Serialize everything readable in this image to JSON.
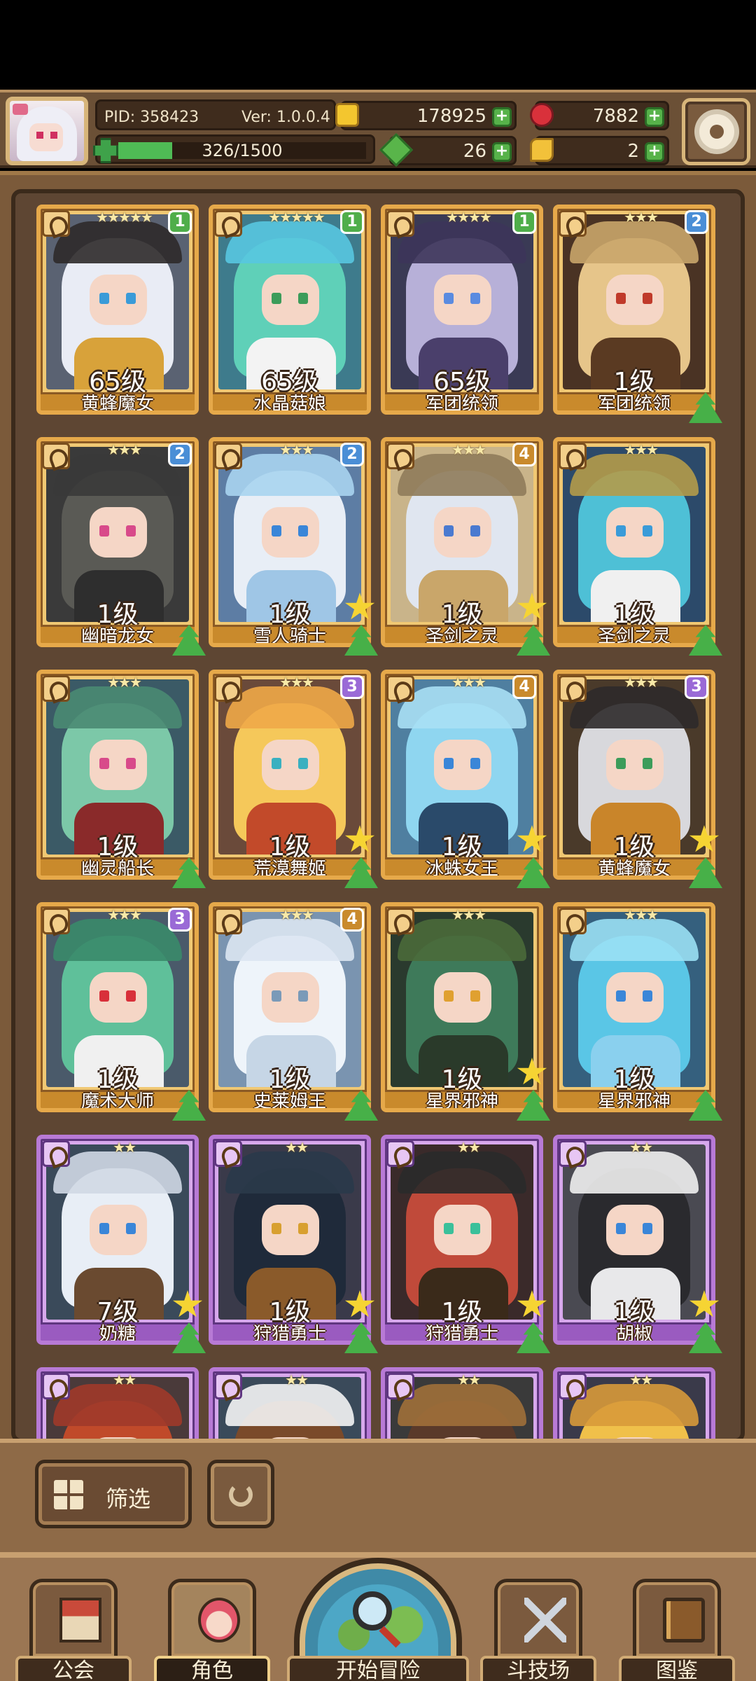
{
  "header": {
    "pid": "PID: 358423",
    "version": "Ver: 1.0.0.4",
    "exp_text": "326/1500",
    "exp_progress": 0.217,
    "gold": "178925",
    "gems": "7882",
    "leaves": "26",
    "keys": "2",
    "plus": "+"
  },
  "cards": [
    {
      "stars": "★★★★★",
      "badge": "1",
      "level": "65级",
      "name": "黄蜂魔女",
      "frame": "gold",
      "up": false,
      "star": false,
      "hair": "#e9ecf5",
      "body": "#d8a23a",
      "hat": "#2e2a2a",
      "eye": "#3a9bd8",
      "bg": "#5a6272"
    },
    {
      "stars": "★★★★★",
      "badge": "1",
      "level": "65级",
      "name": "水晶菇娘",
      "frame": "gold",
      "up": false,
      "star": false,
      "hair": "#5fd0b8",
      "body": "#f3f3f3",
      "hat": "#58c6e0",
      "eye": "#3c9c5a",
      "bg": "#3e7b8c"
    },
    {
      "stars": "★★★★",
      "badge": "1",
      "level": "65级",
      "name": "军团统领",
      "frame": "gold",
      "up": false,
      "star": false,
      "hair": "#b7b0d8",
      "body": "#4a3f6b",
      "hat": "#3d355a",
      "eye": "#5a8be0",
      "bg": "#3a3a55"
    },
    {
      "stars": "★★★",
      "badge": "2",
      "level": "1级",
      "name": "军团统领",
      "frame": "gold",
      "up": true,
      "star": false,
      "hair": "#e6c58a",
      "body": "#5a3a22",
      "hat": "#c9a56a",
      "eye": "#c03a2a",
      "bg": "#4a3324"
    },
    {
      "stars": "★★★",
      "badge": "2",
      "level": "1级",
      "name": "幽暗龙女",
      "frame": "gold",
      "up": true,
      "star": false,
      "hair": "#5a5a55",
      "body": "#2e2e2e",
      "hat": "#3a3a3a",
      "eye": "#d84a8a",
      "bg": "#3a3a3a"
    },
    {
      "stars": "★★★",
      "badge": "2",
      "level": "1级",
      "name": "雪人骑士",
      "frame": "gold",
      "up": true,
      "star": true,
      "hair": "#e8eef6",
      "body": "#9fc6e6",
      "hat": "#a8d4f0",
      "eye": "#3a86d8",
      "bg": "#5d7da4"
    },
    {
      "stars": "★★★",
      "badge": "4",
      "level": "1级",
      "name": "圣剑之灵",
      "frame": "gold",
      "up": true,
      "star": true,
      "hair": "#e0e6f0",
      "body": "#c9a66a",
      "hat": "#8f7b5a",
      "eye": "#4a7ad0",
      "bg": "#c9b48a"
    },
    {
      "stars": "★★★",
      "badge": "",
      "level": "1级",
      "name": "圣剑之灵",
      "frame": "gold",
      "up": true,
      "star": false,
      "hair": "#4ec0d6",
      "body": "#f0f0f0",
      "hat": "#b49b4a",
      "eye": "#3a9bd8",
      "bg": "#2c4a6a"
    },
    {
      "stars": "★★★",
      "badge": "",
      "level": "1级",
      "name": "幽灵船长",
      "frame": "gold",
      "up": true,
      "star": false,
      "hair": "#7cc8a8",
      "body": "#8a2a2a",
      "hat": "#4a8a72",
      "eye": "#d84a8a",
      "bg": "#3b5a66"
    },
    {
      "stars": "★★★",
      "badge": "3",
      "level": "1级",
      "name": "荒漠舞姬",
      "frame": "gold",
      "up": true,
      "star": true,
      "hair": "#f5c85a",
      "body": "#c24a2a",
      "hat": "#f0a848",
      "eye": "#3ab0c0",
      "bg": "#6a4a3a"
    },
    {
      "stars": "★★★",
      "badge": "4",
      "level": "1级",
      "name": "冰蛛女王",
      "frame": "gold",
      "up": true,
      "star": true,
      "hair": "#8fd6f0",
      "body": "#2a4a6a",
      "hat": "#a8e0f4",
      "eye": "#3a86d8",
      "bg": "#4f7fa0"
    },
    {
      "stars": "★★★",
      "badge": "3",
      "level": "1级",
      "name": "黄蜂魔女",
      "frame": "gold",
      "up": true,
      "star": true,
      "hair": "#d8d8dc",
      "body": "#c9852a",
      "hat": "#2e2a2a",
      "eye": "#3c9c5a",
      "bg": "#4a3a2a"
    },
    {
      "stars": "★★★",
      "badge": "3",
      "level": "1级",
      "name": "魔术大师",
      "frame": "gold",
      "up": true,
      "star": false,
      "hair": "#5fc09a",
      "body": "#f0f0f0",
      "hat": "#3a8a6a",
      "eye": "#d8303a",
      "bg": "#4a5a6a"
    },
    {
      "stars": "★★★",
      "badge": "4",
      "level": "1级",
      "name": "史莱姆王",
      "frame": "gold",
      "up": true,
      "star": false,
      "hair": "#eef4fa",
      "body": "#c6d6e6",
      "hat": "#dbe6f2",
      "eye": "#7a9ab8",
      "bg": "#7a94b0"
    },
    {
      "stars": "★★★",
      "badge": "",
      "level": "1级",
      "name": "星界邪神",
      "frame": "gold",
      "up": true,
      "star": true,
      "hair": "#3e7a5a",
      "body": "#2a3a2a",
      "hat": "#4a6a3a",
      "eye": "#e0a030",
      "bg": "#2a3a2e"
    },
    {
      "stars": "★★★",
      "badge": "",
      "level": "1级",
      "name": "星界邪神",
      "frame": "gold",
      "up": true,
      "star": false,
      "hair": "#5ac6e6",
      "body": "#8ad0ee",
      "hat": "#9ae0f4",
      "eye": "#3a86d8",
      "bg": "#35607e"
    },
    {
      "stars": "★★",
      "badge": "",
      "level": "7级",
      "name": "奶糖",
      "frame": "purple",
      "up": true,
      "star": true,
      "hair": "#e8eef6",
      "body": "#6a4a30",
      "hat": "#d0d8e4",
      "eye": "#3a86d8",
      "bg": "#3a4a5a"
    },
    {
      "stars": "★★",
      "badge": "",
      "level": "1级",
      "name": "狩猎勇士",
      "frame": "purple",
      "up": true,
      "star": true,
      "hair": "#1f2a3a",
      "body": "#8a5a2a",
      "hat": "#2a3a4a",
      "eye": "#d8a030",
      "bg": "#3a3a4a"
    },
    {
      "stars": "★★",
      "badge": "",
      "level": "1级",
      "name": "狩猎勇士",
      "frame": "purple",
      "up": true,
      "star": true,
      "hair": "#c04a3a",
      "body": "#3a2a1a",
      "hat": "#2a2a2a",
      "eye": "#3ac09a",
      "bg": "#3a2a2a"
    },
    {
      "stars": "★★",
      "badge": "",
      "level": "1级",
      "name": "胡椒",
      "frame": "purple",
      "up": true,
      "star": true,
      "hair": "#2a2a2e",
      "body": "#e8e8ea",
      "hat": "#f0f0f0",
      "eye": "#3a86d8",
      "bg": "#4a4a52"
    },
    {
      "stars": "★★",
      "badge": "",
      "level": "",
      "name": "",
      "frame": "purple",
      "up": false,
      "star": false,
      "hair": "#c04a2a",
      "body": "#8a3a2a",
      "hat": "#a03a2a",
      "eye": "#3a86d8",
      "bg": "#4a3a3a"
    },
    {
      "stars": "★★",
      "badge": "",
      "level": "",
      "name": "",
      "frame": "purple",
      "up": false,
      "star": false,
      "hair": "#7a4a2a",
      "body": "#f0f0f0",
      "hat": "#f4f4f4",
      "eye": "#3a86d8",
      "bg": "#3a4a5a"
    },
    {
      "stars": "★★",
      "badge": "",
      "level": "",
      "name": "",
      "frame": "purple",
      "up": false,
      "star": false,
      "hair": "#5a3a2a",
      "body": "#8a5a3a",
      "hat": "#a0703a",
      "eye": "#3a86d8",
      "bg": "#3a3a3a"
    },
    {
      "stars": "★★",
      "badge": "",
      "level": "",
      "name": "",
      "frame": "purple",
      "up": false,
      "star": false,
      "hair": "#f0c04a",
      "body": "#e0a030",
      "hat": "#d89a3a",
      "eye": "#3a86d8",
      "bg": "#3a3a4a"
    }
  ],
  "badge_colors": {
    "1": "#4fae4a",
    "2": "#4a8ed6",
    "3": "#9a6ad6",
    "4": "#c98a2c"
  },
  "toolbar": {
    "filter_label": "筛选"
  },
  "nav": {
    "guild": "公会",
    "role": "角色",
    "adventure": "开始冒险",
    "arena": "斗技场",
    "codex": "图鉴"
  }
}
